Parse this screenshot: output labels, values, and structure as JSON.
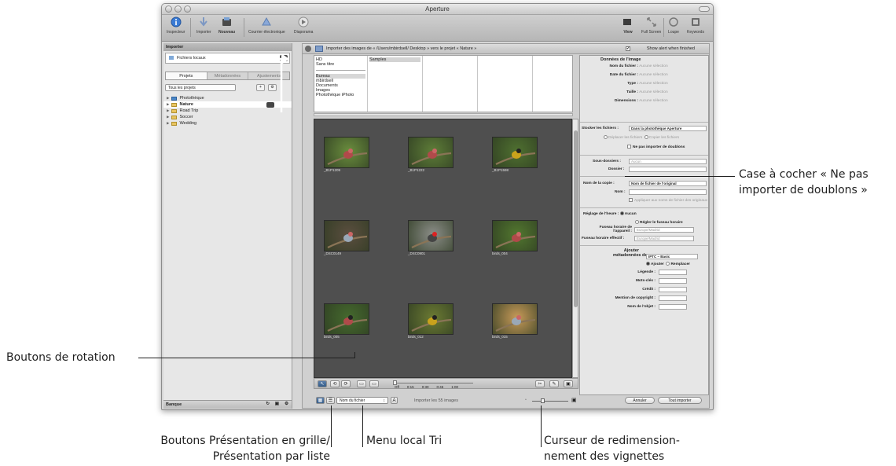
{
  "window": {
    "title": "Aperture"
  },
  "toolbar": {
    "items": [
      "Inspecteur",
      "Importer",
      "Nouveau",
      "Courrier électronique",
      "Diaporama"
    ],
    "right_items": [
      "View",
      "Full Screen",
      "Loupe",
      "Keywords"
    ]
  },
  "sidebar": {
    "header": "Importer",
    "source": "Fichiers locaux",
    "tabs": [
      "Projets",
      "Métadonnées",
      "Ajustements"
    ],
    "filter": "Tous les projets",
    "projects": [
      "Photothèque",
      "Nature",
      "Road Trip",
      "Soccer",
      "Wedding"
    ],
    "footer": "Banque"
  },
  "import_bar": {
    "label": "Importer des images de « /Users/mbirdsell/ Desktop » vers le projet « Nature »",
    "alert_label": "Show alert when finished"
  },
  "browser": {
    "col1_top": [
      "HD",
      "Sans titre"
    ],
    "col1_bottom": [
      "Bureau",
      "mbirdsell",
      "Documents",
      "Images",
      "Photothèque iPhoto"
    ],
    "col2": [
      "Samples"
    ]
  },
  "thumbnails": [
    {
      "caption": "_B1P1209",
      "hue": "#6a8d3d"
    },
    {
      "caption": "_B1P1222",
      "hue": "#5e7d38"
    },
    {
      "caption": "_B1P1598",
      "hue": "#4f7030"
    },
    {
      "caption": "_DSC0149",
      "hue": "#5b4e3f"
    },
    {
      "caption": "_DSC0901",
      "hue": "#8b8d88"
    },
    {
      "caption": "birds_004",
      "hue": "#52772f"
    },
    {
      "caption": "birds_005",
      "hue": "#456a2e"
    },
    {
      "caption": "birds_012",
      "hue": "#6b7a33"
    },
    {
      "caption": "birds_015",
      "hue": "#c79a58"
    }
  ],
  "grid_tools": {
    "timecodes": [
      "Off",
      "0:15",
      "0:30",
      "0:45",
      "1:00"
    ]
  },
  "bottom_bar": {
    "sort_menu": "Nom du fichier",
    "sort_dir": "A",
    "status": "Importer les 55 images",
    "cancel": "Annuler",
    "import_all": "Tout importer"
  },
  "inspector": {
    "title": "Données de l'image",
    "file_labels": [
      "Nom du fichier :",
      "Date du fichier :",
      "Type :",
      "Taille :",
      "Dimensions :"
    ],
    "none": "Aucune sélection",
    "store_label": "Stocker les fichiers :",
    "store_value": "Dans la photothèque Aperture",
    "move_label": "Déplacer les fichiers",
    "copy_label": "Copier les fichiers",
    "no_dup_label": "Ne pas importer de doublons",
    "subfolders_label": "Sous-dossiers :",
    "subfolders_value": "Aucun",
    "folder_label": "Dossier :",
    "copy_name_label": "Nom de la copie :",
    "copy_name_value": "Nom de fichier de l'original",
    "name_label": "Nom :",
    "apply_label": "Appliquer aux noms de fichier des originaux",
    "time_label": "Réglage de l'heure :",
    "time_none": "Aucun",
    "time_set": "Régler le fuseau horaire",
    "tz_device_label": "Fuseau horaire de l'appareil :",
    "tz_device_value": "Europe/Madrid",
    "tz_effective_label": "Fuseau horaire effectif :",
    "tz_effective_value": "Europe/Madrid",
    "meta_label_1": "Ajouter",
    "meta_label_2": "métadonnées de :",
    "meta_value": "IPTC – Basic",
    "add_label": "Ajouter",
    "replace_label": "Remplacer",
    "fields": [
      "Légende :",
      "Mots-clés :",
      "Crédit :",
      "Mention de copyright :",
      "Nom de l'objet :"
    ]
  },
  "callouts": {
    "duplicates": "Case à cocher « Ne pas importer de doublons »",
    "rotation": "Boutons de rotation",
    "view_buttons_1": "Boutons Présentation en grille/",
    "view_buttons_2": "Présentation par liste",
    "sort": "Menu local Tri",
    "slider_1": "Curseur de redimension-",
    "slider_2": "nement des vignettes"
  }
}
